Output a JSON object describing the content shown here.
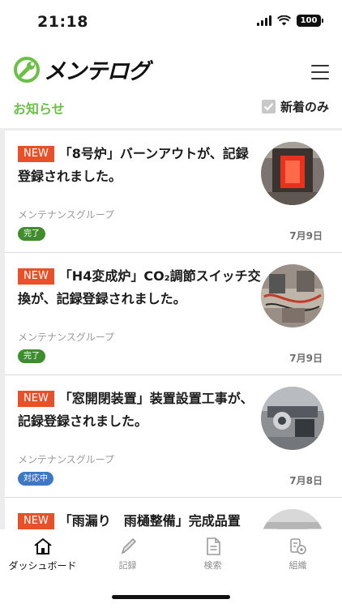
{
  "status_bar": {
    "time": "21:18",
    "battery": "100"
  },
  "header": {
    "logo_text": "メンテログ"
  },
  "section": {
    "title": "お知らせ",
    "filter_label": "新着のみ"
  },
  "notices": [
    {
      "badge": "NEW",
      "title": "「8号炉」バーンアウトが、記録登録されました。",
      "group": "メンテナンスグループ",
      "status": "完了",
      "date": "7月9日"
    },
    {
      "badge": "NEW",
      "title": "「H4変成炉」CO₂調節スイッチ交換が、記録登録されました。",
      "group": "メンテナンスグループ",
      "status": "完了",
      "date": "7月9日"
    },
    {
      "badge": "NEW",
      "title": "「窓開閉装置」装置設置工事が、記録登録されました。",
      "group": "メンテナンスグループ",
      "status": "対応中",
      "date": "7月8日"
    },
    {
      "badge": "NEW",
      "title": "「雨漏り　雨樋整備」完成品置",
      "group": "",
      "status": "",
      "date": ""
    }
  ],
  "tabs": [
    {
      "label": "ダッシュボード",
      "icon": "home-icon"
    },
    {
      "label": "記録",
      "icon": "pen-icon"
    },
    {
      "label": "検索",
      "icon": "document-icon"
    },
    {
      "label": "組織",
      "icon": "org-settings-icon"
    }
  ],
  "colors": {
    "brand_green": "#6cc047",
    "new_badge": "#e8502a",
    "status_done": "#3f8d2f",
    "status_in_progress": "#3f78c2"
  }
}
